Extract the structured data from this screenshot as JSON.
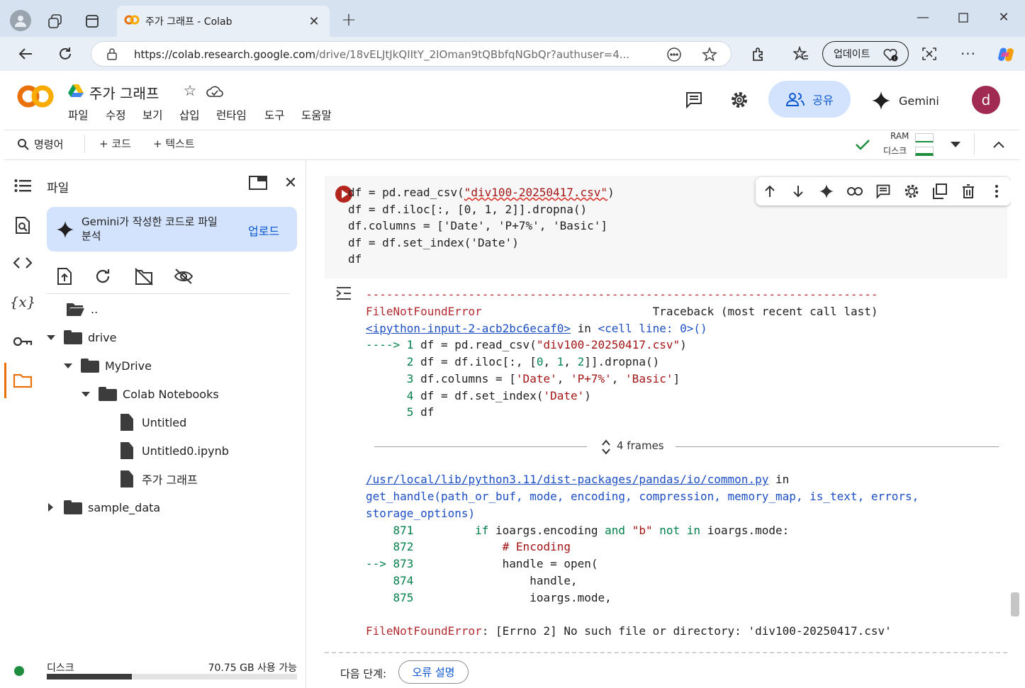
{
  "browser": {
    "tab_title": "주가 그래프 - Colab",
    "url_host": "https://colab.research.google.com",
    "url_path": "/drive/18vELJtJkQIItY_2IOman9tQBbfqNGbQr?authuser=4...",
    "update_label": "업데이트"
  },
  "colab": {
    "logo": "CO",
    "notebook_title": "주가 그래프",
    "menu": [
      "파일",
      "수정",
      "보기",
      "삽입",
      "런타임",
      "도구",
      "도움말"
    ],
    "share_label": "공유",
    "gemini_label": "Gemini",
    "avatar_letter": "d",
    "toolbar": {
      "commands": "명령어",
      "add_code": "+ 코드",
      "add_text": "+ 텍스트",
      "ram": "RAM",
      "disk": "디스크"
    }
  },
  "file_panel": {
    "title": "파일",
    "gemini_card_text": "Gemini가 작성한 코드로 파일 분석",
    "upload_label": "업로드",
    "tree": [
      {
        "name": "..",
        "type": "folder-open"
      },
      {
        "name": "drive",
        "type": "folder"
      },
      {
        "name": "MyDrive",
        "type": "folder"
      },
      {
        "name": "Colab Notebooks",
        "type": "folder"
      },
      {
        "name": "Untitled",
        "type": "file"
      },
      {
        "name": "Untitled0.ipynb",
        "type": "file"
      },
      {
        "name": "주가 그래프",
        "type": "file"
      },
      {
        "name": "sample_data",
        "type": "folder"
      }
    ],
    "disk_label": "디스크",
    "disk_value": "70.75 GB 사용 가능",
    "disk_used_fraction": 0.34
  },
  "cell": {
    "code_lines": [
      "df = pd.read_csv(\"div100-20250417.csv\")",
      "df = df.iloc[:, [0, 1, 2]].dropna()",
      "df.columns = ['Date', 'P+7%', 'Basic']",
      "df = df.set_index('Date')",
      "df"
    ]
  },
  "output": {
    "dash_line": "---------------------------------------------------------------------------",
    "error_name": "FileNotFoundError",
    "traceback_label": "Traceback (most recent call last)",
    "input_ref": "<ipython-input-2-acb2bc6ecaf0>",
    "in_word": "in",
    "cell_ref": "<cell line: 0>()",
    "frames_label": "4 frames",
    "common_path": "/usr/local/lib/python3.11/dist-packages/pandas/io/common.py",
    "get_handle_sig": "get_handle(path_or_buf, mode, encoding, compression, memory_map, is_text, errors,",
    "storage_options": "storage_options)",
    "final_error": "FileNotFoundError: [Errno 2] No such file or directory: 'div100-20250417.csv'"
  },
  "next_steps": {
    "label": "다음 단계:",
    "explain_button": "오류 설명"
  }
}
